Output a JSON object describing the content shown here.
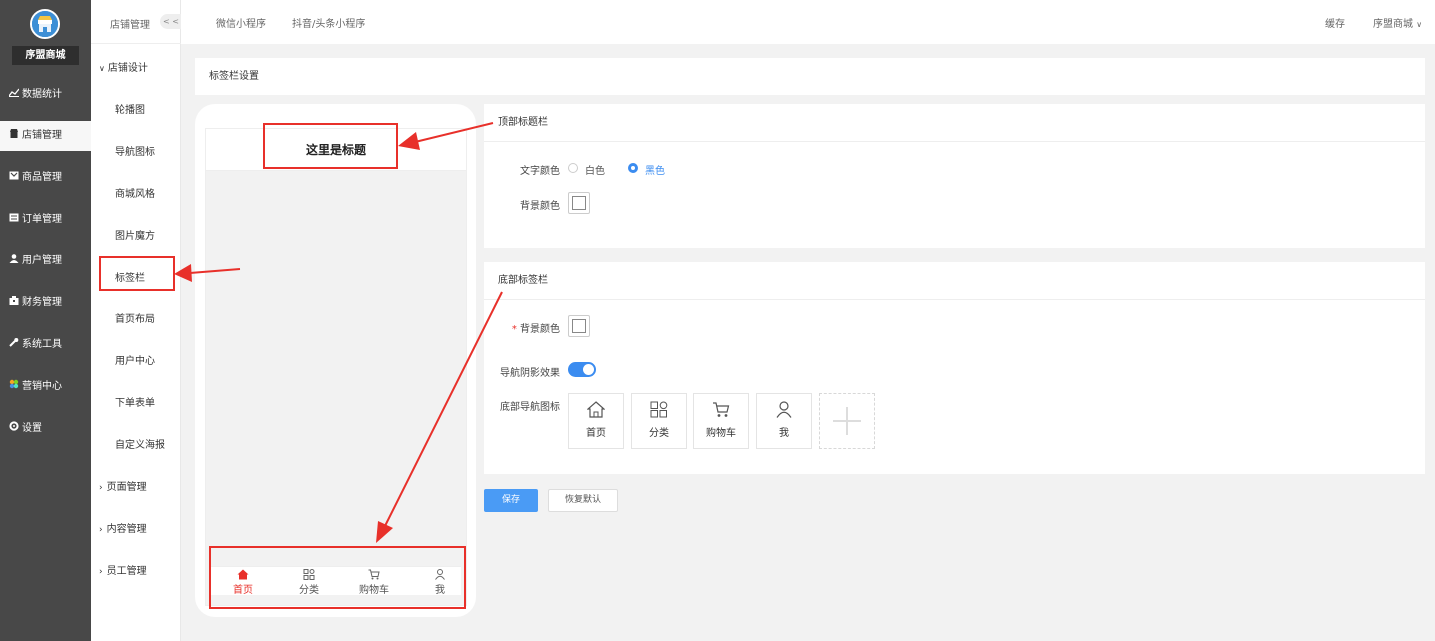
{
  "sidebar": {
    "brand": "序盟商城",
    "items": [
      {
        "label": "数据统计",
        "icon": "chart-icon"
      },
      {
        "label": "店铺管理",
        "icon": "store-icon",
        "active": true
      },
      {
        "label": "商品管理",
        "icon": "goods-icon"
      },
      {
        "label": "订单管理",
        "icon": "order-icon"
      },
      {
        "label": "用户管理",
        "icon": "user-icon"
      },
      {
        "label": "财务管理",
        "icon": "finance-icon"
      },
      {
        "label": "系统工具",
        "icon": "wrench-icon"
      },
      {
        "label": "营销中心",
        "icon": "marketing-icon"
      },
      {
        "label": "设置",
        "icon": "gear-icon"
      }
    ]
  },
  "subnav": {
    "title": "店铺管理",
    "collapse": "< <",
    "group_design": "店铺设计",
    "items": [
      "轮播图",
      "导航图标",
      "商城风格",
      "图片魔方",
      "标签栏",
      "首页布局",
      "用户中心",
      "下单表单",
      "自定义海报"
    ],
    "groups": [
      "页面管理",
      "内容管理",
      "员工管理"
    ]
  },
  "topbar": {
    "tabs": [
      "微信小程序",
      "抖音/头条小程序"
    ],
    "cache": "缓存",
    "store": "序盟商城"
  },
  "page": {
    "title": "标签栏设置"
  },
  "preview": {
    "title": "这里是标题",
    "tabs": [
      {
        "label": "首页",
        "icon": "home-icon"
      },
      {
        "label": "分类",
        "icon": "category-icon"
      },
      {
        "label": "购物车",
        "icon": "cart-icon"
      },
      {
        "label": "我",
        "icon": "person-icon"
      }
    ]
  },
  "top_panel": {
    "title": "顶部标题栏",
    "text_color_label": "文字颜色",
    "options": [
      "白色",
      "黑色"
    ],
    "selected": "黑色",
    "bg_label": "背景颜色"
  },
  "bottom_panel": {
    "title": "底部标签栏",
    "bg_label": "背景颜色",
    "required_mark": "*",
    "shadow_label": "导航阴影效果",
    "shadow_on": true,
    "icons_label": "底部导航图标",
    "nav_items": [
      {
        "label": "首页",
        "icon": "home-icon"
      },
      {
        "label": "分类",
        "icon": "category-icon"
      },
      {
        "label": "购物车",
        "icon": "cart-icon"
      },
      {
        "label": "我",
        "icon": "person-icon"
      }
    ]
  },
  "buttons": {
    "save": "保存",
    "reset": "恢复默认"
  },
  "colors": {
    "sidebar": "#484848",
    "accent": "#3b8cf0",
    "annotation_red": "#e8302a",
    "active_tab": "#e8302a"
  }
}
